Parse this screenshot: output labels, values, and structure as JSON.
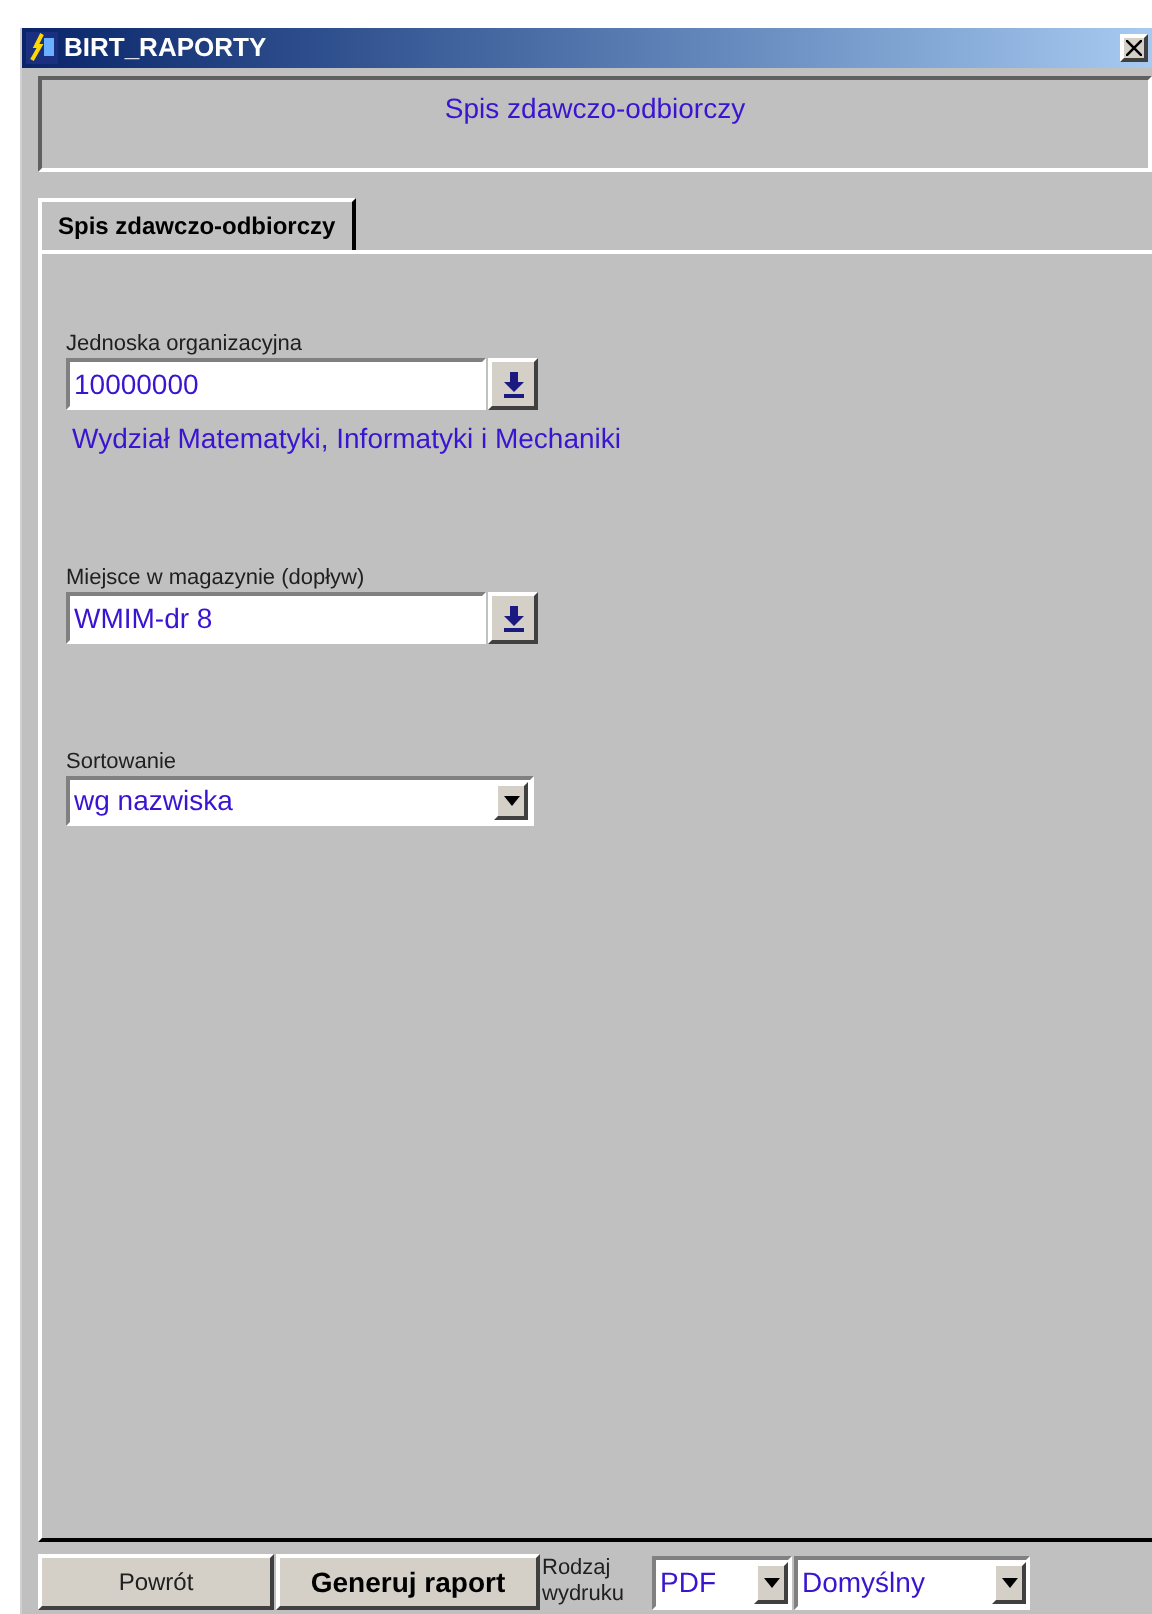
{
  "window": {
    "title": "BIRT_RAPORTY"
  },
  "header": {
    "title": "Spis zdawczo-odbiorczy"
  },
  "tabs": [
    {
      "label": "Spis zdawczo-odbiorczy",
      "selected": true
    }
  ],
  "fields": [
    {
      "kind": "lookup",
      "label": "Jednoska organizacyjna",
      "value": "10000000",
      "description": "Wydział Matematyki, Informatyki i Mechaniki"
    },
    {
      "kind": "lookup",
      "label": "Miejsce w magazynie (dopływ)",
      "value": "WMIM-dr 8"
    },
    {
      "kind": "select",
      "label": "Sortowanie",
      "value": "wg nazwiska"
    }
  ],
  "footer": {
    "back_button": "Powrót",
    "generate_button": "Generuj raport",
    "output_label": "Rodzaj wydruku",
    "format": "PDF",
    "template": "Domyślny"
  }
}
